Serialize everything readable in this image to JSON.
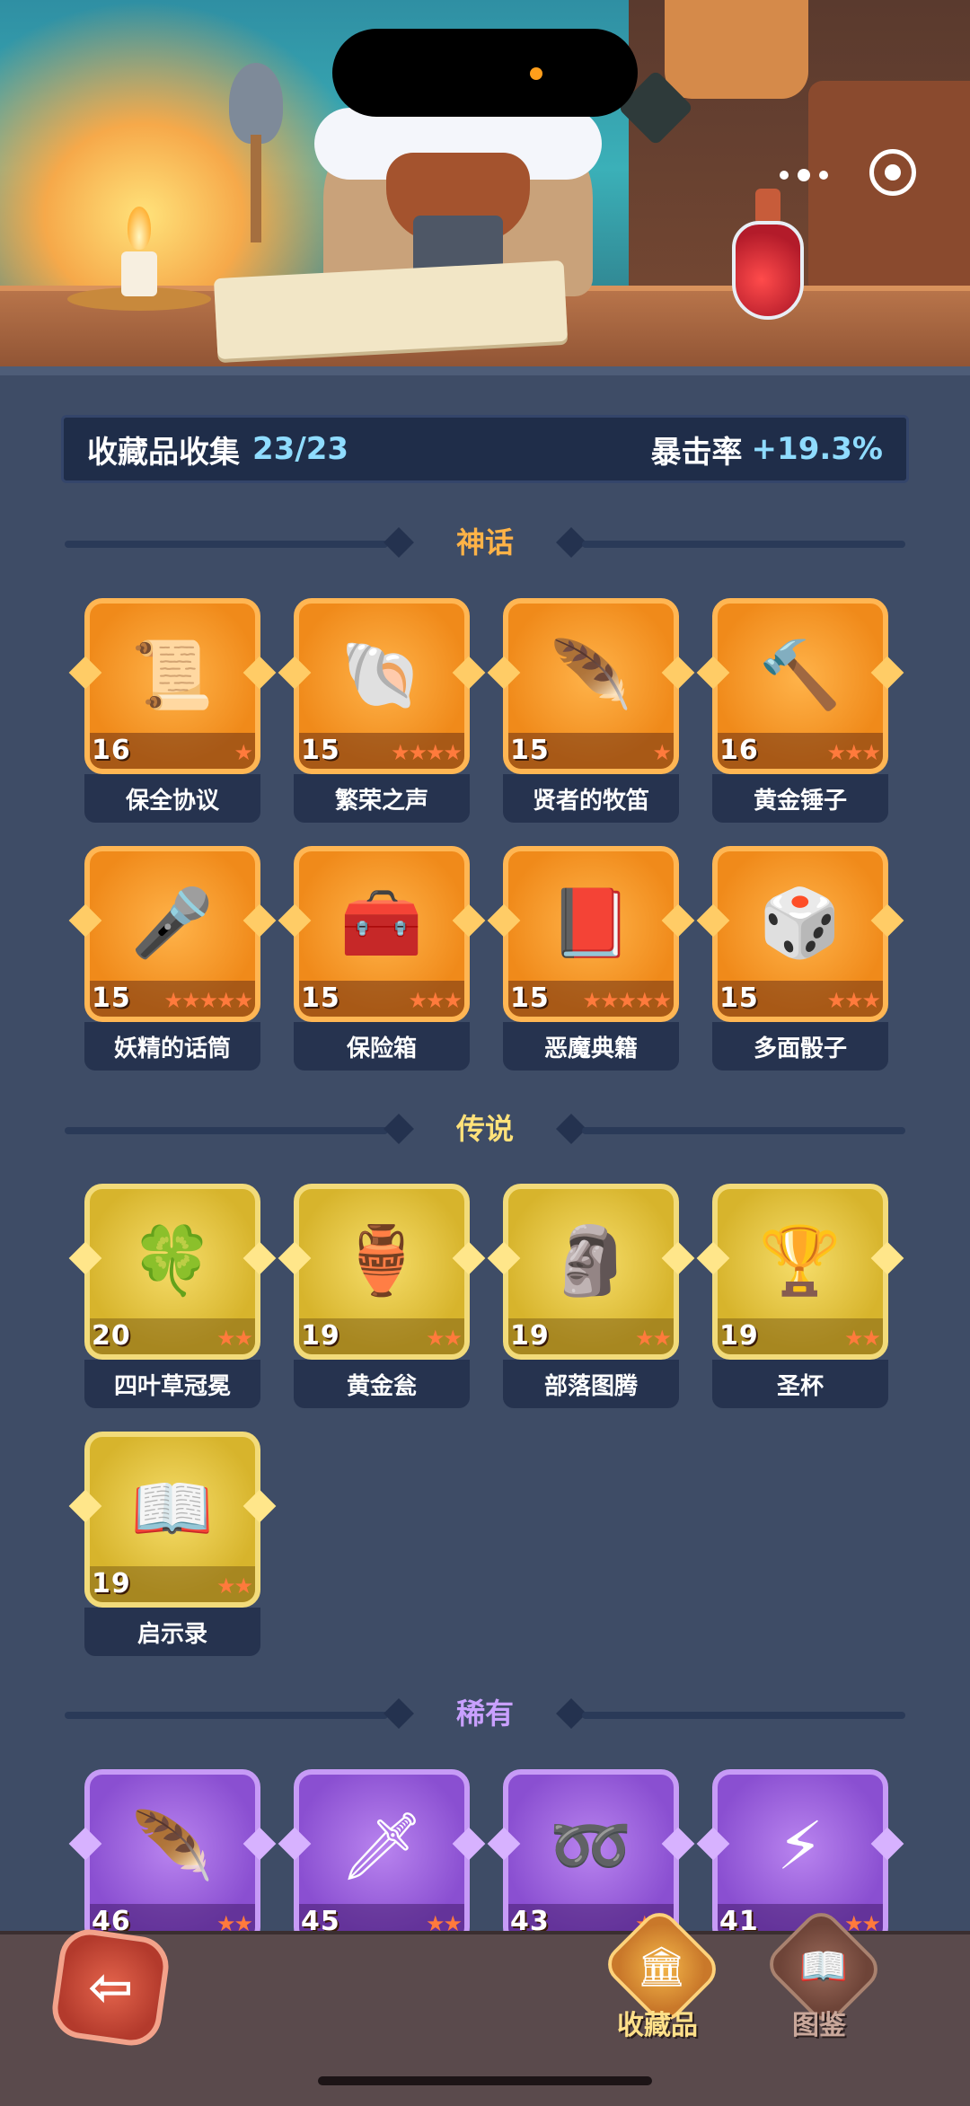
{
  "header": {
    "collection_label": "收藏品收集",
    "collection_count": "23/23",
    "crit_label": "暴击率",
    "crit_value": "+19.3%"
  },
  "sections": [
    {
      "title": "神话",
      "rarity": "myth",
      "title_color": "#ffb347",
      "items": [
        {
          "name": "保全协议",
          "level": "16",
          "stars": 1,
          "icon": "contract-scroll-icon",
          "glyph": "📜"
        },
        {
          "name": "繁荣之声",
          "level": "15",
          "stars": 4,
          "icon": "blue-horn-icon",
          "glyph": "🐚"
        },
        {
          "name": "贤者的牧笛",
          "level": "15",
          "stars": 1,
          "icon": "pan-flute-icon",
          "glyph": "🪶"
        },
        {
          "name": "黄金锤子",
          "level": "16",
          "stars": 3,
          "icon": "golden-hammer-icon",
          "glyph": "🔨"
        },
        {
          "name": "妖精的话筒",
          "level": "15",
          "stars": 5,
          "icon": "fairy-microphone-icon",
          "glyph": "🎤"
        },
        {
          "name": "保险箱",
          "level": "15",
          "stars": 3,
          "icon": "treasure-chest-icon",
          "glyph": "🧰"
        },
        {
          "name": "恶魔典籍",
          "level": "15",
          "stars": 5,
          "icon": "demon-tome-icon",
          "glyph": "📕"
        },
        {
          "name": "多面骰子",
          "level": "15",
          "stars": 3,
          "icon": "polyhedral-dice-icon",
          "glyph": "🎲"
        }
      ]
    },
    {
      "title": "传说",
      "rarity": "leg",
      "title_color": "#ffe27a",
      "items": [
        {
          "name": "四叶草冠冕",
          "level": "20",
          "stars": 2,
          "icon": "clover-crown-icon",
          "glyph": "🍀"
        },
        {
          "name": "黄金瓮",
          "level": "19",
          "stars": 2,
          "icon": "golden-urn-icon",
          "glyph": "🏺"
        },
        {
          "name": "部落图腾",
          "level": "19",
          "stars": 2,
          "icon": "tribal-totem-icon",
          "glyph": "🗿"
        },
        {
          "name": "圣杯",
          "level": "19",
          "stars": 2,
          "icon": "holy-grail-icon",
          "glyph": "🏆"
        },
        {
          "name": "启示录",
          "level": "19",
          "stars": 2,
          "icon": "open-book-icon",
          "glyph": "📖"
        }
      ]
    },
    {
      "title": "稀有",
      "rarity": "rare",
      "title_color": "#c9a0ff",
      "items": [
        {
          "name": "",
          "level": "46",
          "stars": 2,
          "icon": "phoenix-feather-icon",
          "glyph": "🪶"
        },
        {
          "name": "",
          "level": "45",
          "stars": 2,
          "icon": "frost-dagger-icon",
          "glyph": "🗡"
        },
        {
          "name": "",
          "level": "43",
          "stars": 2,
          "icon": "vine-rings-icon",
          "glyph": "➿"
        },
        {
          "name": "",
          "level": "41",
          "stars": 2,
          "icon": "lightning-crystal-icon",
          "glyph": "⚡"
        }
      ]
    }
  ],
  "nav": {
    "back_icon": "back-arrow-icon",
    "tabs": [
      {
        "label": "收藏品",
        "icon": "collection-icon",
        "active": true
      },
      {
        "label": "图鉴",
        "icon": "codex-book-icon",
        "active": false
      }
    ]
  }
}
